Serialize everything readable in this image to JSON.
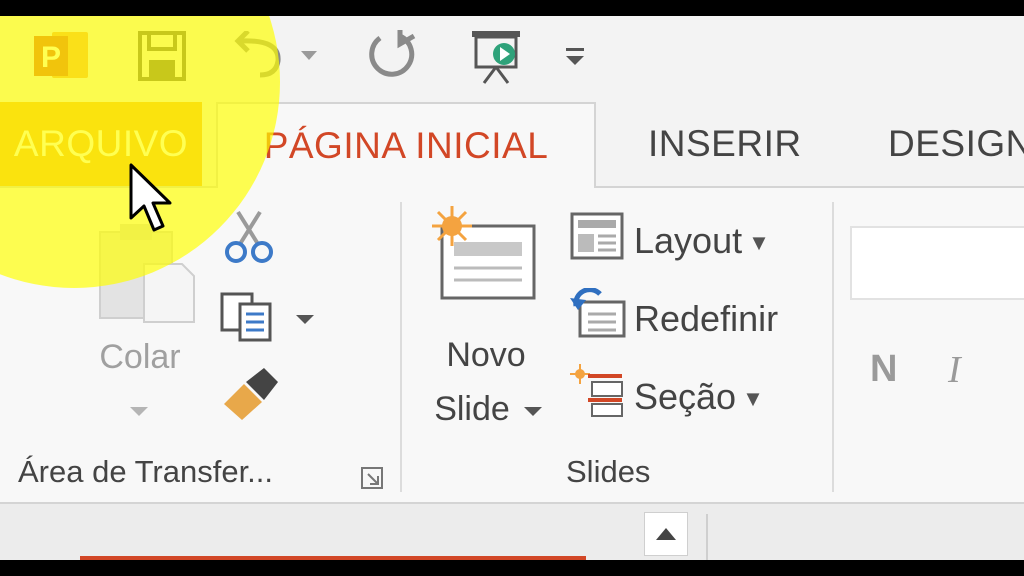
{
  "colors": {
    "accent": "#d24726",
    "file_tab": "#f0a92c",
    "highlight": "#ffff00",
    "ribbon_bg": "#f8f8f8"
  },
  "quick_access": {
    "icons": [
      "powerpoint-icon",
      "save-icon",
      "undo-icon",
      "redo-icon",
      "slideshow-icon",
      "customize-icon"
    ],
    "app_badge": "P"
  },
  "tabs": [
    {
      "label": "ARQUIVO"
    },
    {
      "label": "PÁGINA INICIAL"
    },
    {
      "label": "INSERIR"
    },
    {
      "label": "DESIGN"
    }
  ],
  "ribbon": {
    "clipboard": {
      "paste_label": "Colar",
      "group_label": "Área de Transfer..."
    },
    "slides": {
      "new_slide_label_1": "Novo",
      "new_slide_label_2": "Slide",
      "layout_label": "Layout",
      "reset_label": "Redefinir",
      "section_label": "Seção",
      "group_label": "Slides"
    },
    "font": {
      "bold_label": "N",
      "italic_label": "I"
    }
  }
}
